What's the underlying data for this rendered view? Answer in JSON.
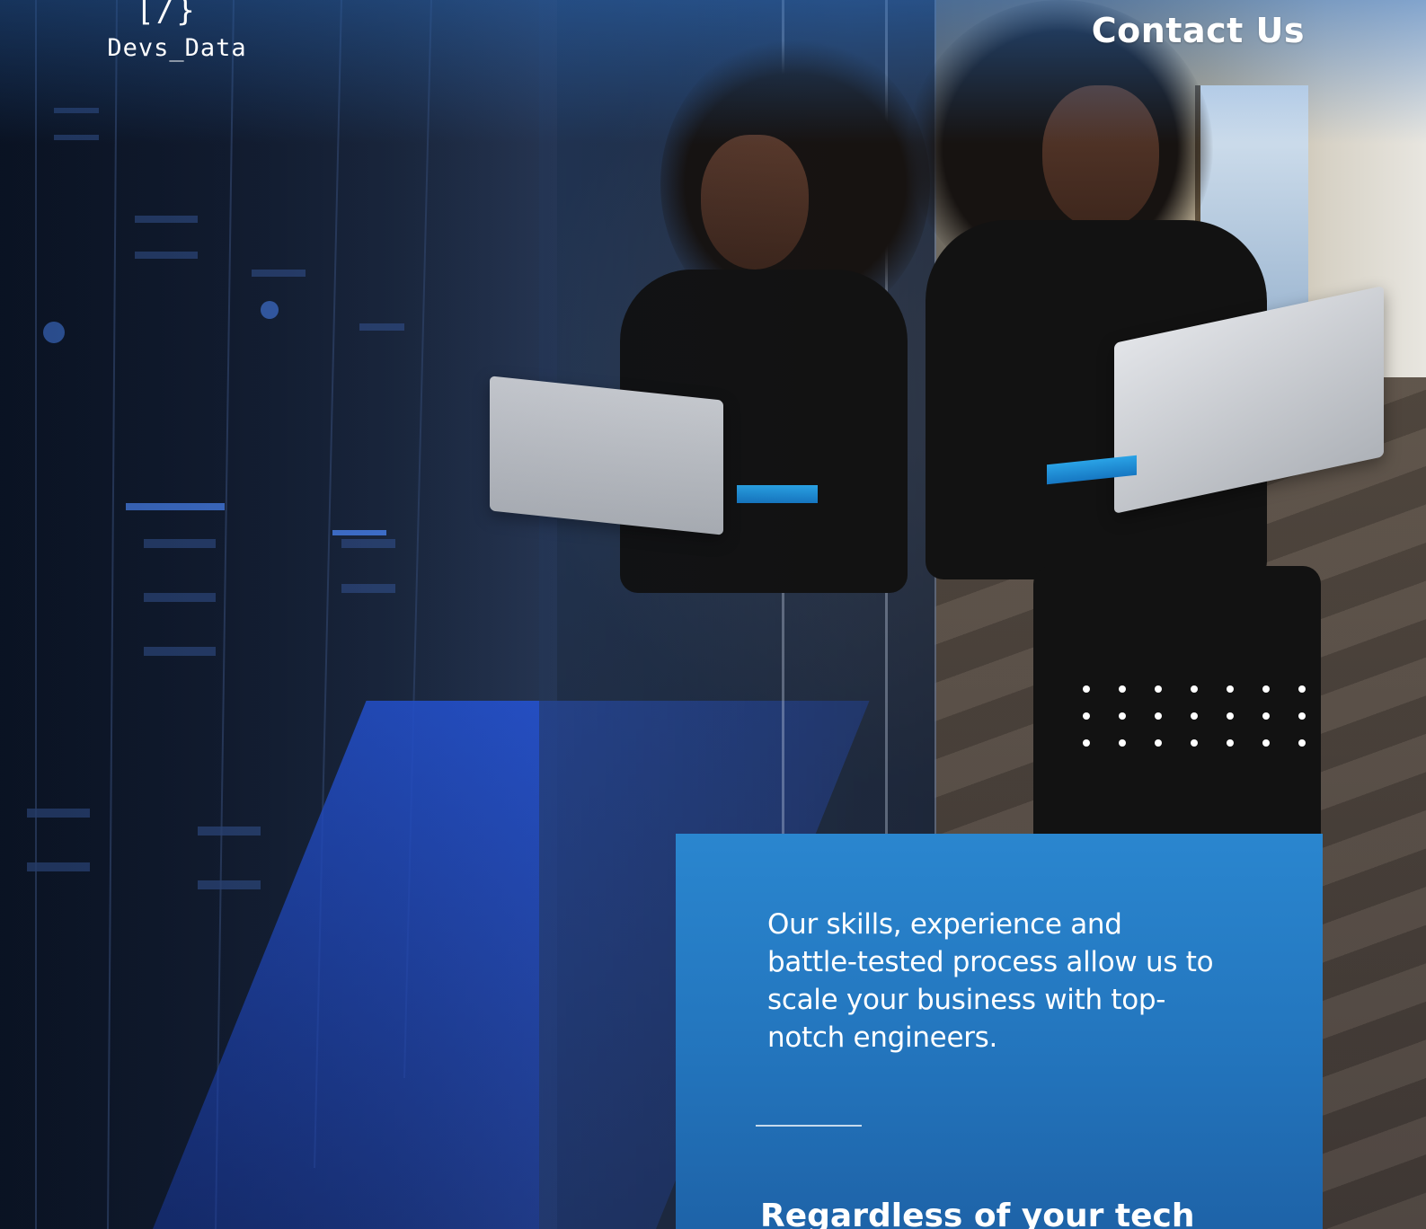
{
  "brand": {
    "logo_mark": "[/}",
    "name": "Devs_Data"
  },
  "nav": {
    "contact_label": "Contact Us"
  },
  "hero": {
    "body_text": "Our skills, experience and battle-tested process allow us to scale your business with top-notch engineers.",
    "heading_text": "Regardless of your tech"
  },
  "decor": {
    "dot_grid_rows": 3,
    "dot_grid_cols": 7
  },
  "colors": {
    "panel_blue": "#2375bd",
    "text_white": "#ffffff"
  },
  "icons": {
    "logo": "code-bracket-icon"
  }
}
